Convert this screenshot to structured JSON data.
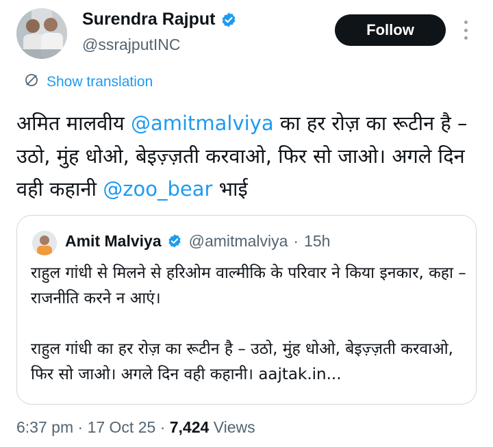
{
  "author": {
    "name": "Surendra Rajput",
    "handle": "@ssrajputINC",
    "verified": true
  },
  "actions": {
    "follow_label": "Follow"
  },
  "translation": {
    "label": "Show translation"
  },
  "tweet": {
    "segments": [
      {
        "text": "अमित मालवीय ",
        "mention": false
      },
      {
        "text": "@amitmalviya",
        "mention": true
      },
      {
        "text": " का हर रोज़ का रूटीन है – उठो, मुंह धोओ, बेइज़्ज़ती करवाओ, फिर सो जाओ। अगले दिन वही कहानी ",
        "mention": false
      },
      {
        "text": "@zoo_bear",
        "mention": true
      },
      {
        "text": " भाई",
        "mention": false
      }
    ]
  },
  "quoted": {
    "name": "Amit Malviya",
    "handle": "@amitmalviya",
    "separator": "·",
    "time": "15h",
    "paragraph1": "राहुल गांधी से मिलने से हरिओम वाल्मीकि के परिवार ने किया इनकार, कहा – राजनीति करने न आएं।",
    "paragraph2": "राहुल गांधी का हर रोज़ का रूटीन है – उठो, मुंह धोओ, बेइज़्ज़ती करवाओ, फिर सो जाओ। अगले दिन वही कहानी। aajtak.in..."
  },
  "meta": {
    "time": "6:37 pm",
    "sep1": "·",
    "date": "17 Oct 25",
    "sep2": "·",
    "views_count": "7,424",
    "views_label": "Views"
  },
  "icons": {
    "verified": "verified-badge-icon",
    "translate": "globe-translate-icon",
    "more": "more-options-icon"
  },
  "colors": {
    "accent": "#1d9bf0",
    "text": "#0f1419",
    "secondary": "#536471",
    "border": "#cfd9de",
    "button_bg": "#0f1419"
  }
}
